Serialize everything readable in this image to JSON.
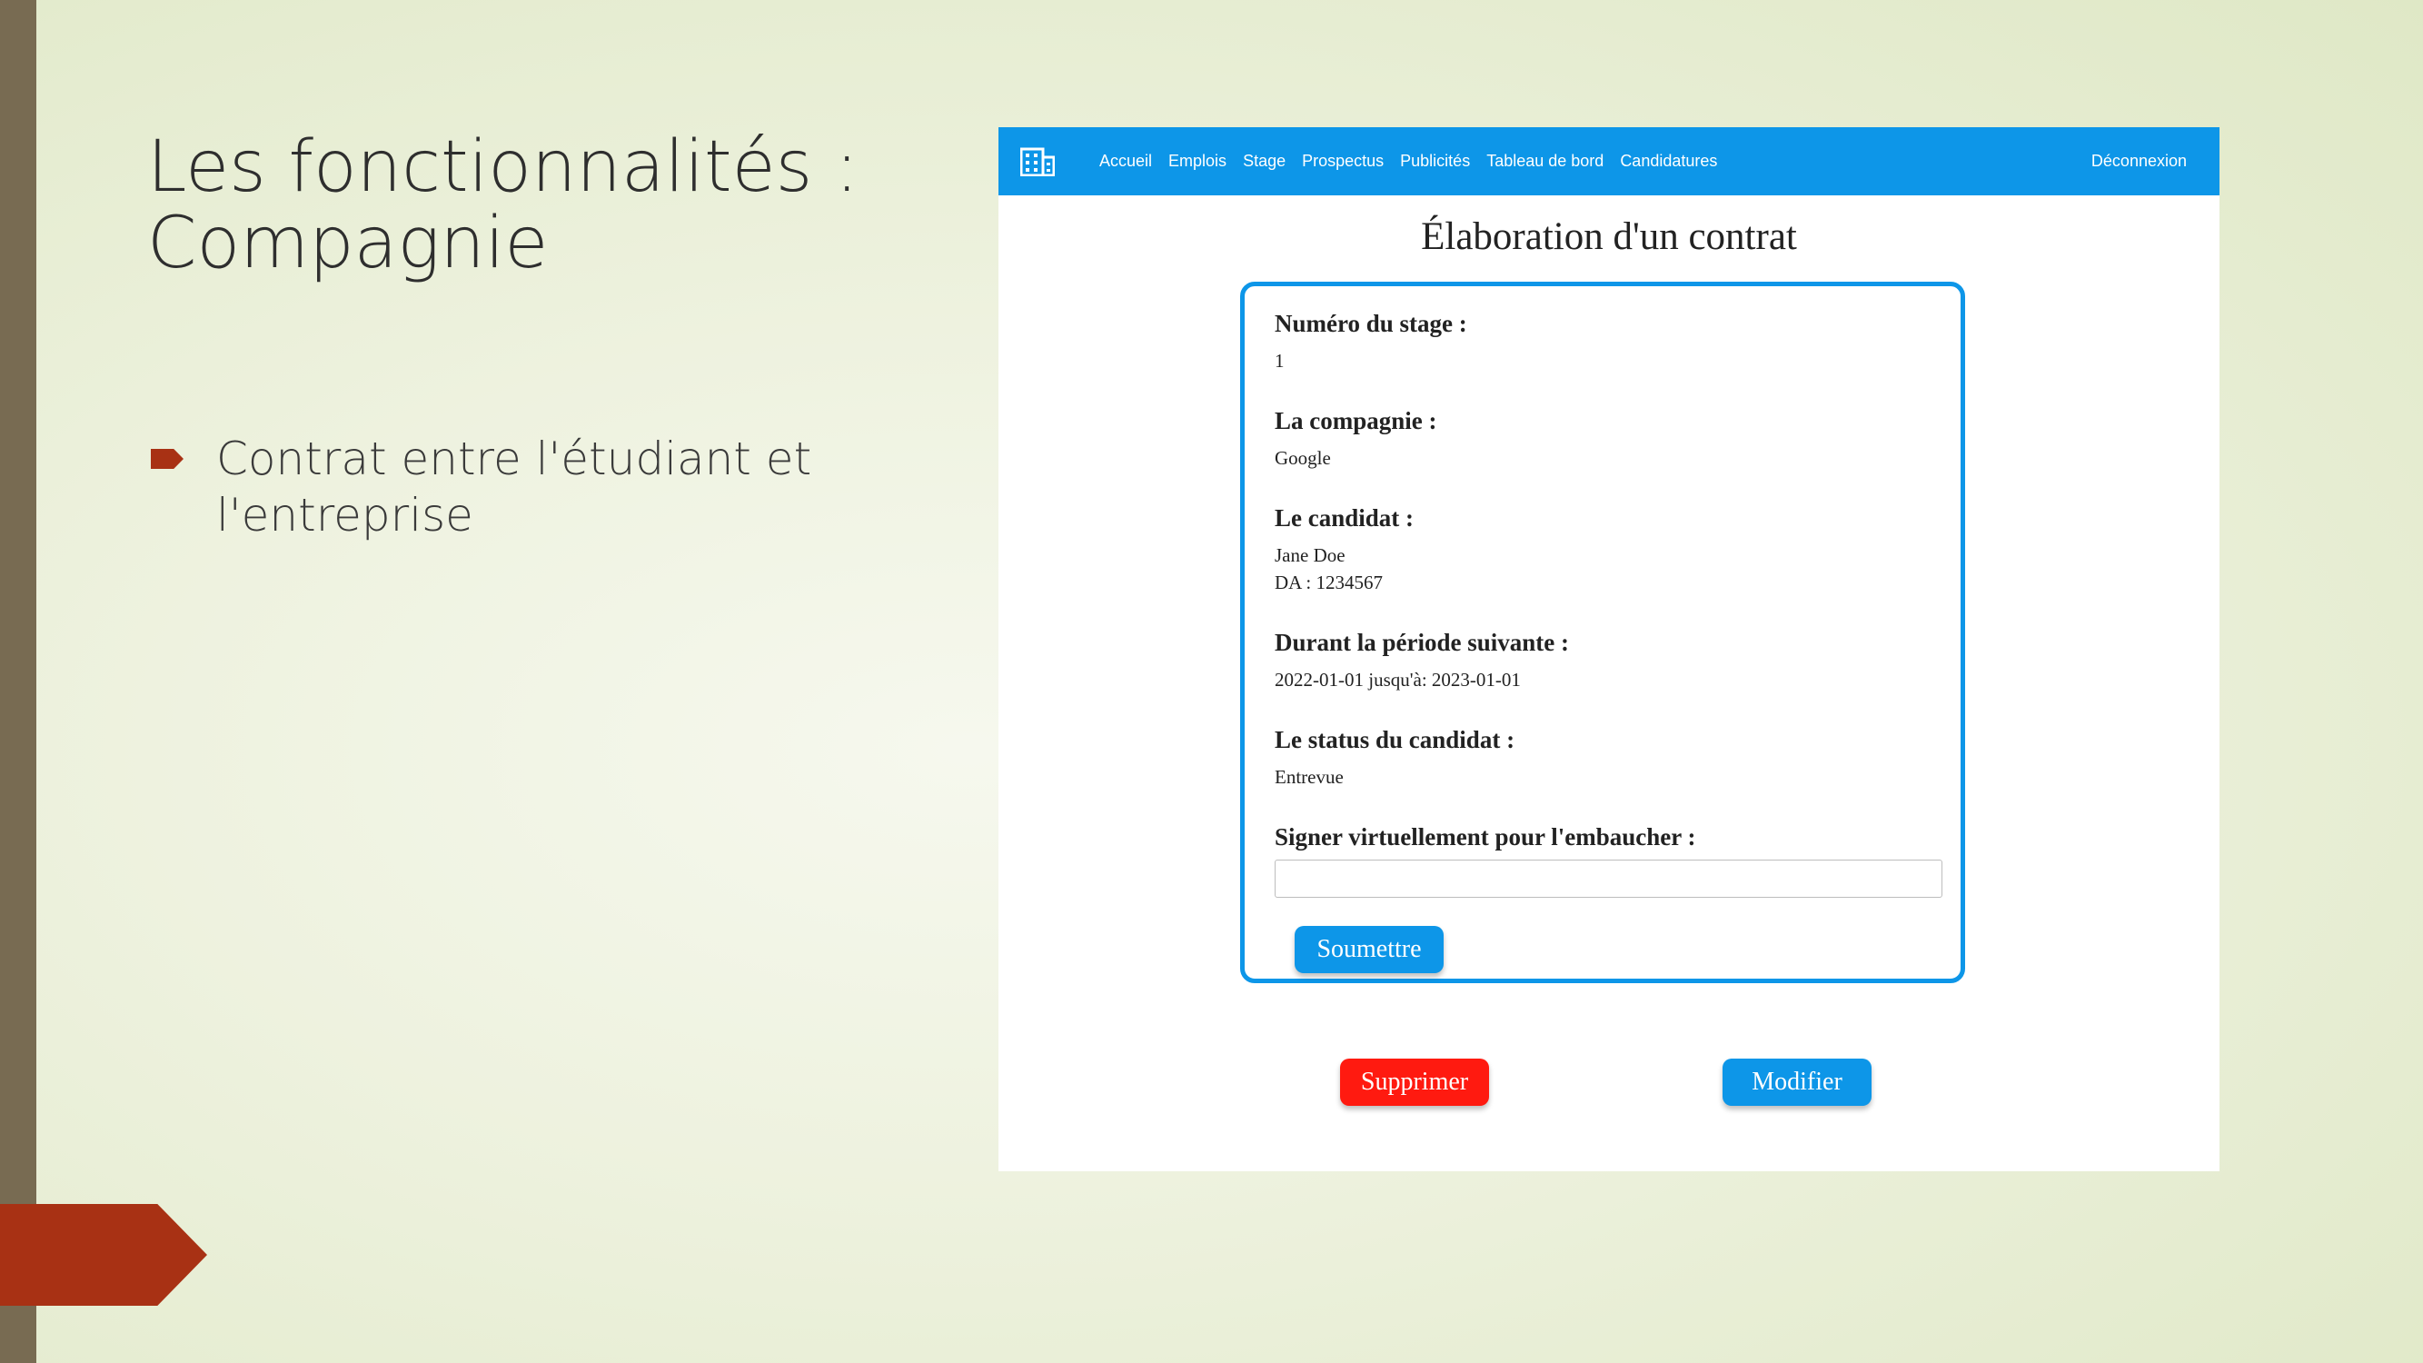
{
  "slide": {
    "title_line1": "Les fonctionnalités :",
    "title_line2": "Compagnie",
    "bullet": "Contrat entre l'étudiant et l'entreprise",
    "accent_color": "#a83114",
    "sidebar_color": "#786b52"
  },
  "app": {
    "brand_color": "#0d96e8",
    "logo_icon": "building-icon",
    "nav": {
      "links": [
        "Accueil",
        "Emplois",
        "Stage",
        "Prospectus",
        "Publicités",
        "Tableau de bord",
        "Candidatures"
      ],
      "logout": "Déconnexion"
    },
    "heading": "Élaboration d'un contrat",
    "form": {
      "stage_label": "Numéro du stage :",
      "stage_value": "1",
      "company_label": "La compagnie :",
      "company_value": "Google",
      "candidate_label": "Le candidat :",
      "candidate_name": "Jane Doe",
      "candidate_da": "DA : 1234567",
      "period_label": "Durant la période suivante :",
      "period_value": "2022-01-01 jusqu'à: 2023-01-01",
      "status_label": "Le status du candidat :",
      "status_value": "Entrevue",
      "sign_label": "Signer virtuellement pour l'embaucher :",
      "sign_value": "",
      "submit_label": "Soumettre"
    },
    "actions": {
      "delete_label": "Supprimer",
      "delete_color": "#ff1a10",
      "edit_label": "Modifier"
    }
  }
}
